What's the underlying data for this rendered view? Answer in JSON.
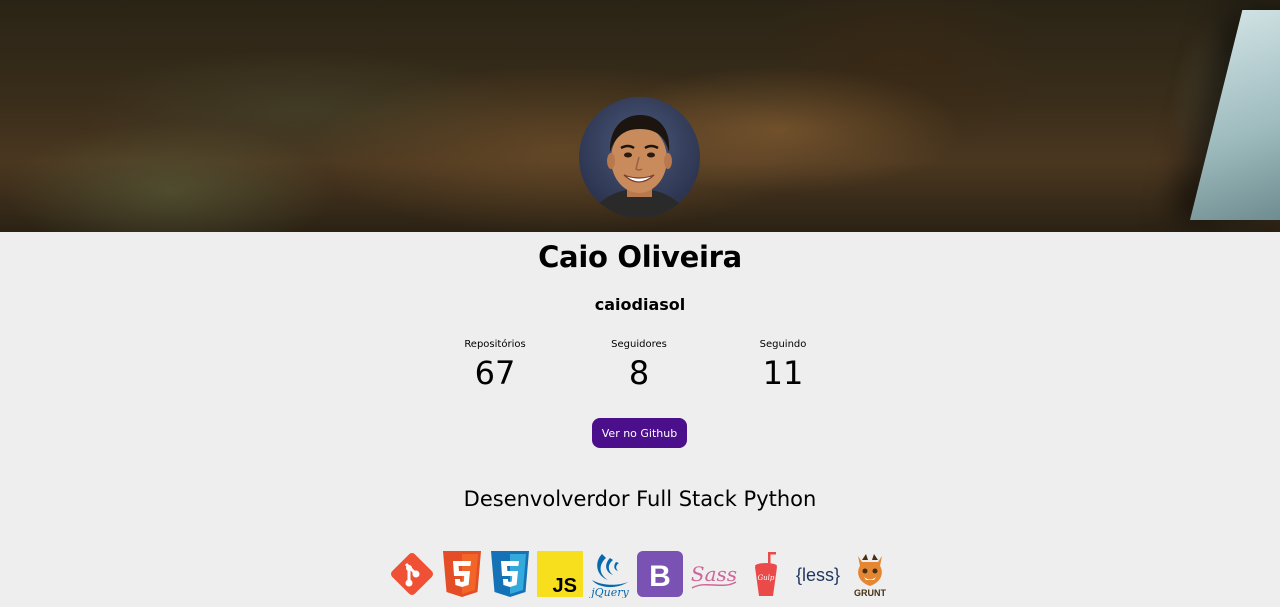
{
  "profile": {
    "name": "Caio Oliveira",
    "username": "caiodiasol",
    "role": "Desenvolverdor Full Stack Python"
  },
  "stats": [
    {
      "label": "Repositórios",
      "value": "67"
    },
    {
      "label": "Seguidores",
      "value": "8"
    },
    {
      "label": "Seguindo",
      "value": "11"
    }
  ],
  "actions": {
    "github_button_label": "Ver no Github"
  },
  "technologies": {
    "js_label": "JS",
    "jquery_label": "jQuery",
    "bootstrap_label": "B",
    "sass_label": "Sass",
    "gulp_label": "Gulp",
    "less_label": "{less}",
    "grunt_label": "GRUNT"
  },
  "colors": {
    "button": "#4b0f8c",
    "background": "#eeeeee",
    "git": "#f05033",
    "html5": "#e44d26",
    "css3": "#1572b6",
    "javascript": "#f7df1e",
    "jquery": "#0769ad",
    "bootstrap": "#7952b3",
    "sass": "#cd6799",
    "gulp": "#eb4a4b",
    "less": "#1d365d",
    "grunt": "#e48632"
  },
  "icons": [
    "git-icon",
    "html5-icon",
    "css3-icon",
    "javascript-icon",
    "jquery-icon",
    "bootstrap-icon",
    "sass-icon",
    "gulp-icon",
    "less-icon",
    "grunt-icon"
  ]
}
